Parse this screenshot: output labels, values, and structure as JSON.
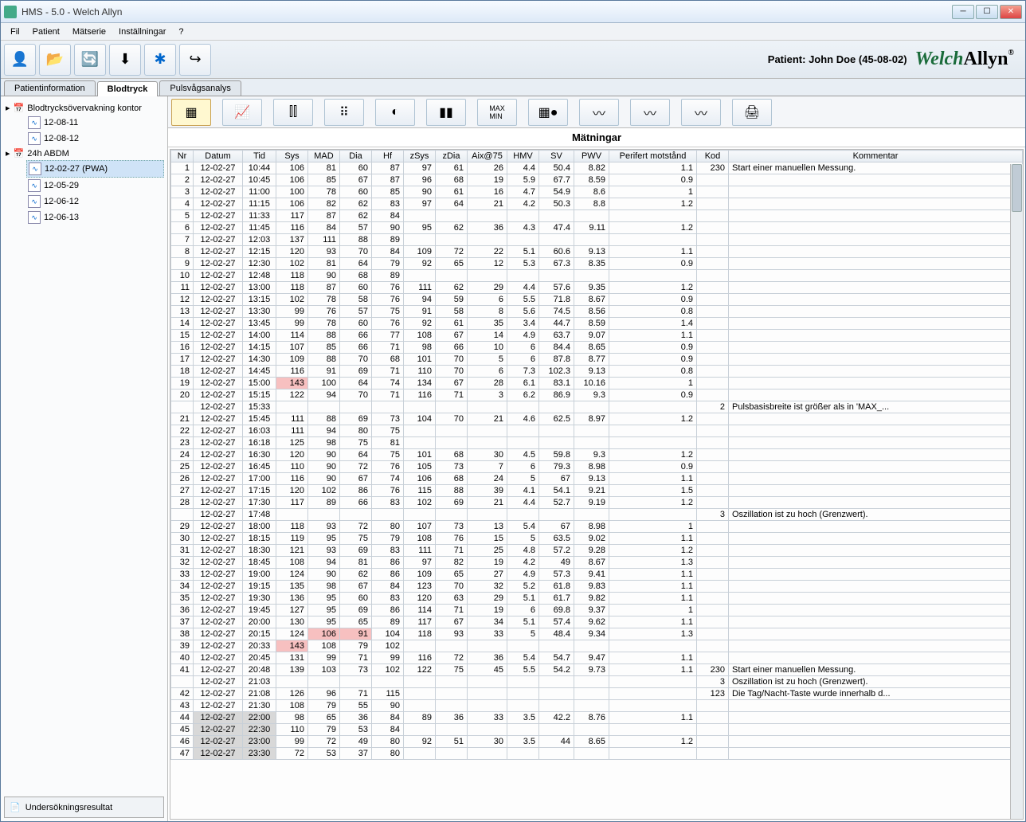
{
  "window": {
    "title": "HMS - 5.0 - Welch Allyn"
  },
  "menu": {
    "file": "Fil",
    "patient": "Patient",
    "series": "Mätserie",
    "settings": "Inställningar",
    "help": "?"
  },
  "patient_label": "Patient: John Doe (45-08-02)",
  "logo": {
    "welch": "Welch",
    "allyn": "Allyn"
  },
  "tabs": {
    "info": "Patientinformation",
    "bp": "Blodtryck",
    "pwa": "Pulsvågsanalys"
  },
  "tree": {
    "root1": "Blodtrycksövervakning kontor",
    "r1_children": [
      "12-08-11",
      "12-08-12"
    ],
    "root2": "24h ABDM",
    "r2_children": [
      "12-02-27 (PWA)",
      "12-05-29",
      "12-06-12",
      "12-06-13"
    ],
    "selected": "12-02-27 (PWA)"
  },
  "results_button": "Undersökningsresultat",
  "section_title": "Mätningar",
  "columns": [
    "Nr",
    "Datum",
    "Tid",
    "Sys",
    "MAD",
    "Dia",
    "Hf",
    "zSys",
    "zDia",
    "Aix@75",
    "HMV",
    "SV",
    "PWV",
    "Perifert motstånd",
    "Kod",
    "Kommentar"
  ],
  "chart_data": {
    "type": "table",
    "rows": [
      {
        "nr": 1,
        "da": "12-02-27",
        "ti": "10:44",
        "sy": 106,
        "ma": 81,
        "di": 60,
        "hf": 87,
        "zs": 97,
        "zd": 61,
        "ax": 26,
        "hm": 4.4,
        "sv": 50.4,
        "pw": 8.82,
        "pm": 1.1,
        "ko": 230,
        "km": "Start einer manuellen Messung."
      },
      {
        "nr": 2,
        "da": "12-02-27",
        "ti": "10:45",
        "sy": 106,
        "ma": 85,
        "di": 67,
        "hf": 87,
        "zs": 96,
        "zd": 68,
        "ax": 19,
        "hm": 5.9,
        "sv": 67.7,
        "pw": 8.59,
        "pm": 0.9
      },
      {
        "nr": 3,
        "da": "12-02-27",
        "ti": "11:00",
        "sy": 100,
        "ma": 78,
        "di": 60,
        "hf": 85,
        "zs": 90,
        "zd": 61,
        "ax": 16,
        "hm": 4.7,
        "sv": 54.9,
        "pw": 8.6,
        "pm": 1.0
      },
      {
        "nr": 4,
        "da": "12-02-27",
        "ti": "11:15",
        "sy": 106,
        "ma": 82,
        "di": 62,
        "hf": 83,
        "zs": 97,
        "zd": 64,
        "ax": 21,
        "hm": 4.2,
        "sv": 50.3,
        "pw": 8.8,
        "pm": 1.2
      },
      {
        "nr": 5,
        "da": "12-02-27",
        "ti": "11:33",
        "sy": 117,
        "ma": 87,
        "di": 62,
        "hf": 84
      },
      {
        "nr": 6,
        "da": "12-02-27",
        "ti": "11:45",
        "sy": 116,
        "ma": 84,
        "di": 57,
        "hf": 90,
        "zs": 95,
        "zd": 62,
        "ax": 36,
        "hm": 4.3,
        "sv": 47.4,
        "pw": 9.11,
        "pm": 1.2
      },
      {
        "nr": 7,
        "da": "12-02-27",
        "ti": "12:03",
        "sy": 137,
        "ma": 111,
        "di": 88,
        "hf": 89
      },
      {
        "nr": 8,
        "da": "12-02-27",
        "ti": "12:15",
        "sy": 120,
        "ma": 93,
        "di": 70,
        "hf": 84,
        "zs": 109,
        "zd": 72,
        "ax": 22,
        "hm": 5.1,
        "sv": 60.6,
        "pw": 9.13,
        "pm": 1.1
      },
      {
        "nr": 9,
        "da": "12-02-27",
        "ti": "12:30",
        "sy": 102,
        "ma": 81,
        "di": 64,
        "hf": 79,
        "zs": 92,
        "zd": 65,
        "ax": 12,
        "hm": 5.3,
        "sv": 67.3,
        "pw": 8.35,
        "pm": 0.9
      },
      {
        "nr": 10,
        "da": "12-02-27",
        "ti": "12:48",
        "sy": 118,
        "ma": 90,
        "di": 68,
        "hf": 89
      },
      {
        "nr": 11,
        "da": "12-02-27",
        "ti": "13:00",
        "sy": 118,
        "ma": 87,
        "di": 60,
        "hf": 76,
        "zs": 111,
        "zd": 62,
        "ax": 29,
        "hm": 4.4,
        "sv": 57.6,
        "pw": 9.35,
        "pm": 1.2
      },
      {
        "nr": 12,
        "da": "12-02-27",
        "ti": "13:15",
        "sy": 102,
        "ma": 78,
        "di": 58,
        "hf": 76,
        "zs": 94,
        "zd": 59,
        "ax": 6,
        "hm": 5.5,
        "sv": 71.8,
        "pw": 8.67,
        "pm": 0.9
      },
      {
        "nr": 13,
        "da": "12-02-27",
        "ti": "13:30",
        "sy": 99,
        "ma": 76,
        "di": 57,
        "hf": 75,
        "zs": 91,
        "zd": 58,
        "ax": 8,
        "hm": 5.6,
        "sv": 74.5,
        "pw": 8.56,
        "pm": 0.8
      },
      {
        "nr": 14,
        "da": "12-02-27",
        "ti": "13:45",
        "sy": 99,
        "ma": 78,
        "di": 60,
        "hf": 76,
        "zs": 92,
        "zd": 61,
        "ax": 35,
        "hm": 3.4,
        "sv": 44.7,
        "pw": 8.59,
        "pm": 1.4
      },
      {
        "nr": 15,
        "da": "12-02-27",
        "ti": "14:00",
        "sy": 114,
        "ma": 88,
        "di": 66,
        "hf": 77,
        "zs": 108,
        "zd": 67,
        "ax": 14,
        "hm": 4.9,
        "sv": 63.7,
        "pw": 9.07,
        "pm": 1.1
      },
      {
        "nr": 16,
        "da": "12-02-27",
        "ti": "14:15",
        "sy": 107,
        "ma": 85,
        "di": 66,
        "hf": 71,
        "zs": 98,
        "zd": 66,
        "ax": 10,
        "hm": 6.0,
        "sv": 84.4,
        "pw": 8.65,
        "pm": 0.9
      },
      {
        "nr": 17,
        "da": "12-02-27",
        "ti": "14:30",
        "sy": 109,
        "ma": 88,
        "di": 70,
        "hf": 68,
        "zs": 101,
        "zd": 70,
        "ax": 5,
        "hm": 6.0,
        "sv": 87.8,
        "pw": 8.77,
        "pm": 0.9
      },
      {
        "nr": 18,
        "da": "12-02-27",
        "ti": "14:45",
        "sy": 116,
        "ma": 91,
        "di": 69,
        "hf": 71,
        "zs": 110,
        "zd": 70,
        "ax": 6,
        "hm": 7.3,
        "sv": 102.3,
        "pw": 9.13,
        "pm": 0.8
      },
      {
        "nr": 19,
        "da": "12-02-27",
        "ti": "15:00",
        "sy": 143,
        "sy_hi": true,
        "ma": 100,
        "di": 64,
        "hf": 74,
        "zs": 134,
        "zd": 67,
        "ax": 28,
        "hm": 6.1,
        "sv": 83.1,
        "pw": 10.16,
        "pm": 1.0
      },
      {
        "nr": 20,
        "da": "12-02-27",
        "ti": "15:15",
        "sy": 122,
        "ma": 94,
        "di": 70,
        "hf": 71,
        "zs": 116,
        "zd": 71,
        "ax": 3,
        "hm": 6.2,
        "sv": 86.9,
        "pw": 9.3,
        "pm": 0.9
      },
      {
        "da": "12-02-27",
        "ti": "15:33",
        "ko": 2,
        "km": "Pulsbasisbreite ist größer als in 'MAX_..."
      },
      {
        "nr": 21,
        "da": "12-02-27",
        "ti": "15:45",
        "sy": 111,
        "ma": 88,
        "di": 69,
        "hf": 73,
        "zs": 104,
        "zd": 70,
        "ax": 21,
        "hm": 4.6,
        "sv": 62.5,
        "pw": 8.97,
        "pm": 1.2
      },
      {
        "nr": 22,
        "da": "12-02-27",
        "ti": "16:03",
        "sy": 111,
        "ma": 94,
        "di": 80,
        "hf": 75
      },
      {
        "nr": 23,
        "da": "12-02-27",
        "ti": "16:18",
        "sy": 125,
        "ma": 98,
        "di": 75,
        "hf": 81
      },
      {
        "nr": 24,
        "da": "12-02-27",
        "ti": "16:30",
        "sy": 120,
        "ma": 90,
        "di": 64,
        "hf": 75,
        "zs": 101,
        "zd": 68,
        "ax": 30,
        "hm": 4.5,
        "sv": 59.8,
        "pw": 9.3,
        "pm": 1.2
      },
      {
        "nr": 25,
        "da": "12-02-27",
        "ti": "16:45",
        "sy": 110,
        "ma": 90,
        "di": 72,
        "hf": 76,
        "zs": 105,
        "zd": 73,
        "ax": 7,
        "hm": 6.0,
        "sv": 79.3,
        "pw": 8.98,
        "pm": 0.9
      },
      {
        "nr": 26,
        "da": "12-02-27",
        "ti": "17:00",
        "sy": 116,
        "ma": 90,
        "di": 67,
        "hf": 74,
        "zs": 106,
        "zd": 68,
        "ax": 24,
        "hm": 5.0,
        "sv": 67.0,
        "pw": 9.13,
        "pm": 1.1
      },
      {
        "nr": 27,
        "da": "12-02-27",
        "ti": "17:15",
        "sy": 120,
        "ma": 102,
        "di": 86,
        "hf": 76,
        "zs": 115,
        "zd": 88,
        "ax": 39,
        "hm": 4.1,
        "sv": 54.1,
        "pw": 9.21,
        "pm": 1.5
      },
      {
        "nr": 28,
        "da": "12-02-27",
        "ti": "17:30",
        "sy": 117,
        "ma": 89,
        "di": 66,
        "hf": 83,
        "zs": 102,
        "zd": 69,
        "ax": 21,
        "hm": 4.4,
        "sv": 52.7,
        "pw": 9.19,
        "pm": 1.2
      },
      {
        "da": "12-02-27",
        "ti": "17:48",
        "ko": 3,
        "km": "Oszillation ist zu hoch (Grenzwert)."
      },
      {
        "nr": 29,
        "da": "12-02-27",
        "ti": "18:00",
        "sy": 118,
        "ma": 93,
        "di": 72,
        "hf": 80,
        "zs": 107,
        "zd": 73,
        "ax": 13,
        "hm": 5.4,
        "sv": 67.0,
        "pw": 8.98,
        "pm": 1.0
      },
      {
        "nr": 30,
        "da": "12-02-27",
        "ti": "18:15",
        "sy": 119,
        "ma": 95,
        "di": 75,
        "hf": 79,
        "zs": 108,
        "zd": 76,
        "ax": 15,
        "hm": 5.0,
        "sv": 63.5,
        "pw": 9.02,
        "pm": 1.1
      },
      {
        "nr": 31,
        "da": "12-02-27",
        "ti": "18:30",
        "sy": 121,
        "ma": 93,
        "di": 69,
        "hf": 83,
        "zs": 111,
        "zd": 71,
        "ax": 25,
        "hm": 4.8,
        "sv": 57.2,
        "pw": 9.28,
        "pm": 1.2
      },
      {
        "nr": 32,
        "da": "12-02-27",
        "ti": "18:45",
        "sy": 108,
        "ma": 94,
        "di": 81,
        "hf": 86,
        "zs": 97,
        "zd": 82,
        "ax": 19,
        "hm": 4.2,
        "sv": 49.0,
        "pw": 8.67,
        "pm": 1.3
      },
      {
        "nr": 33,
        "da": "12-02-27",
        "ti": "19:00",
        "sy": 124,
        "ma": 90,
        "di": 62,
        "hf": 86,
        "zs": 109,
        "zd": 65,
        "ax": 27,
        "hm": 4.9,
        "sv": 57.3,
        "pw": 9.41,
        "pm": 1.1
      },
      {
        "nr": 34,
        "da": "12-02-27",
        "ti": "19:15",
        "sy": 135,
        "ma": 98,
        "di": 67,
        "hf": 84,
        "zs": 123,
        "zd": 70,
        "ax": 32,
        "hm": 5.2,
        "sv": 61.8,
        "pw": 9.83,
        "pm": 1.1
      },
      {
        "nr": 35,
        "da": "12-02-27",
        "ti": "19:30",
        "sy": 136,
        "ma": 95,
        "di": 60,
        "hf": 83,
        "zs": 120,
        "zd": 63,
        "ax": 29,
        "hm": 5.1,
        "sv": 61.7,
        "pw": 9.82,
        "pm": 1.1
      },
      {
        "nr": 36,
        "da": "12-02-27",
        "ti": "19:45",
        "sy": 127,
        "ma": 95,
        "di": 69,
        "hf": 86,
        "zs": 114,
        "zd": 71,
        "ax": 19,
        "hm": 6.0,
        "sv": 69.8,
        "pw": 9.37,
        "pm": 1.0
      },
      {
        "nr": 37,
        "da": "12-02-27",
        "ti": "20:00",
        "sy": 130,
        "ma": 95,
        "di": 65,
        "hf": 89,
        "zs": 117,
        "zd": 67,
        "ax": 34,
        "hm": 5.1,
        "sv": 57.4,
        "pw": 9.62,
        "pm": 1.1
      },
      {
        "nr": 38,
        "da": "12-02-27",
        "ti": "20:15",
        "sy": 124,
        "ma": 106,
        "ma_hi": true,
        "di": 91,
        "di_hi": true,
        "hf": 104,
        "zs": 118,
        "zd": 93,
        "ax": 33,
        "hm": 5.0,
        "sv": 48.4,
        "pw": 9.34,
        "pm": 1.3
      },
      {
        "nr": 39,
        "da": "12-02-27",
        "ti": "20:33",
        "sy": 143,
        "sy_hi": true,
        "ma": 108,
        "di": 79,
        "hf": 102
      },
      {
        "nr": 40,
        "da": "12-02-27",
        "ti": "20:45",
        "sy": 131,
        "ma": 99,
        "di": 71,
        "hf": 99,
        "zs": 116,
        "zd": 72,
        "ax": 36,
        "hm": 5.4,
        "sv": 54.7,
        "pw": 9.47,
        "pm": 1.1
      },
      {
        "nr": 41,
        "da": "12-02-27",
        "ti": "20:48",
        "sy": 139,
        "ma": 103,
        "di": 73,
        "hf": 102,
        "zs": 122,
        "zd": 75,
        "ax": 45,
        "hm": 5.5,
        "sv": 54.2,
        "pw": 9.73,
        "pm": 1.1,
        "ko": 230,
        "km": "Start einer manuellen Messung."
      },
      {
        "da": "12-02-27",
        "ti": "21:03",
        "ko": 3,
        "km": "Oszillation ist zu hoch (Grenzwert)."
      },
      {
        "nr": 42,
        "da": "12-02-27",
        "ti": "21:08",
        "sy": 126,
        "ma": 96,
        "di": 71,
        "hf": 115,
        "ko": 123,
        "km": "Die Tag/Nacht-Taste wurde innerhalb d..."
      },
      {
        "nr": 43,
        "da": "12-02-27",
        "ti": "21:30",
        "sy": 108,
        "ma": 79,
        "di": 55,
        "hf": 90
      },
      {
        "nr": 44,
        "da": "12-02-27",
        "ti": "22:00",
        "sy": 98,
        "ma": 65,
        "di": 36,
        "hf": 84,
        "zs": 89,
        "zd": 36,
        "ax": 33,
        "hm": 3.5,
        "sv": 42.2,
        "pw": 8.76,
        "pm": 1.1,
        "night": true
      },
      {
        "nr": 45,
        "da": "12-02-27",
        "ti": "22:30",
        "sy": 110,
        "ma": 79,
        "di": 53,
        "hf": 84,
        "night": true
      },
      {
        "nr": 46,
        "da": "12-02-27",
        "ti": "23:00",
        "sy": 99,
        "ma": 72,
        "di": 49,
        "hf": 80,
        "zs": 92,
        "zd": 51,
        "ax": 30,
        "hm": 3.5,
        "sv": 44.0,
        "pw": 8.65,
        "pm": 1.2,
        "night": true
      },
      {
        "nr": 47,
        "da": "12-02-27",
        "ti": "23:30",
        "sy": 72,
        "ma": 53,
        "di": 37,
        "hf": 80,
        "night": true
      }
    ]
  }
}
